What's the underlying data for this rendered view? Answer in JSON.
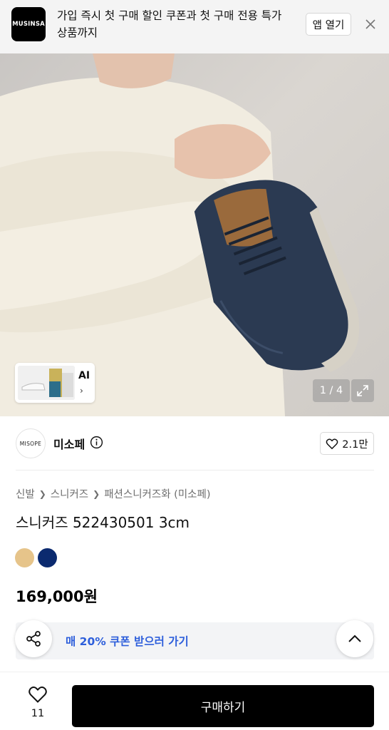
{
  "banner": {
    "logo_text": "MUSINSA",
    "message": "가입 즉시 첫 구매 할인 쿠폰과 첫 구매 전용 특가 상품까지",
    "open_app_label": "앱 열기",
    "close_icon": "close-icon"
  },
  "hero": {
    "ai_label": "AI",
    "ai_chevron": "›",
    "counter": "1 / 4",
    "expand_icon": "expand-icon"
  },
  "brand": {
    "logo_text": "MISOPE",
    "name": "미소페",
    "info_icon": "info-icon",
    "likes": "2.1만"
  },
  "breadcrumb": [
    "신발",
    "스니커즈",
    "패션스니커즈화 (미소페)"
  ],
  "product": {
    "title": "스니커즈 522430501 3cm",
    "colors": [
      "#e6c48a",
      "#0b2a6f"
    ],
    "price": "169,000원"
  },
  "coupon": {
    "text": "매 20% 쿠폰 받으러 가기",
    "color": "#2e5fdb"
  },
  "bottom": {
    "wish_count": "11",
    "buy_label": "구매하기"
  }
}
